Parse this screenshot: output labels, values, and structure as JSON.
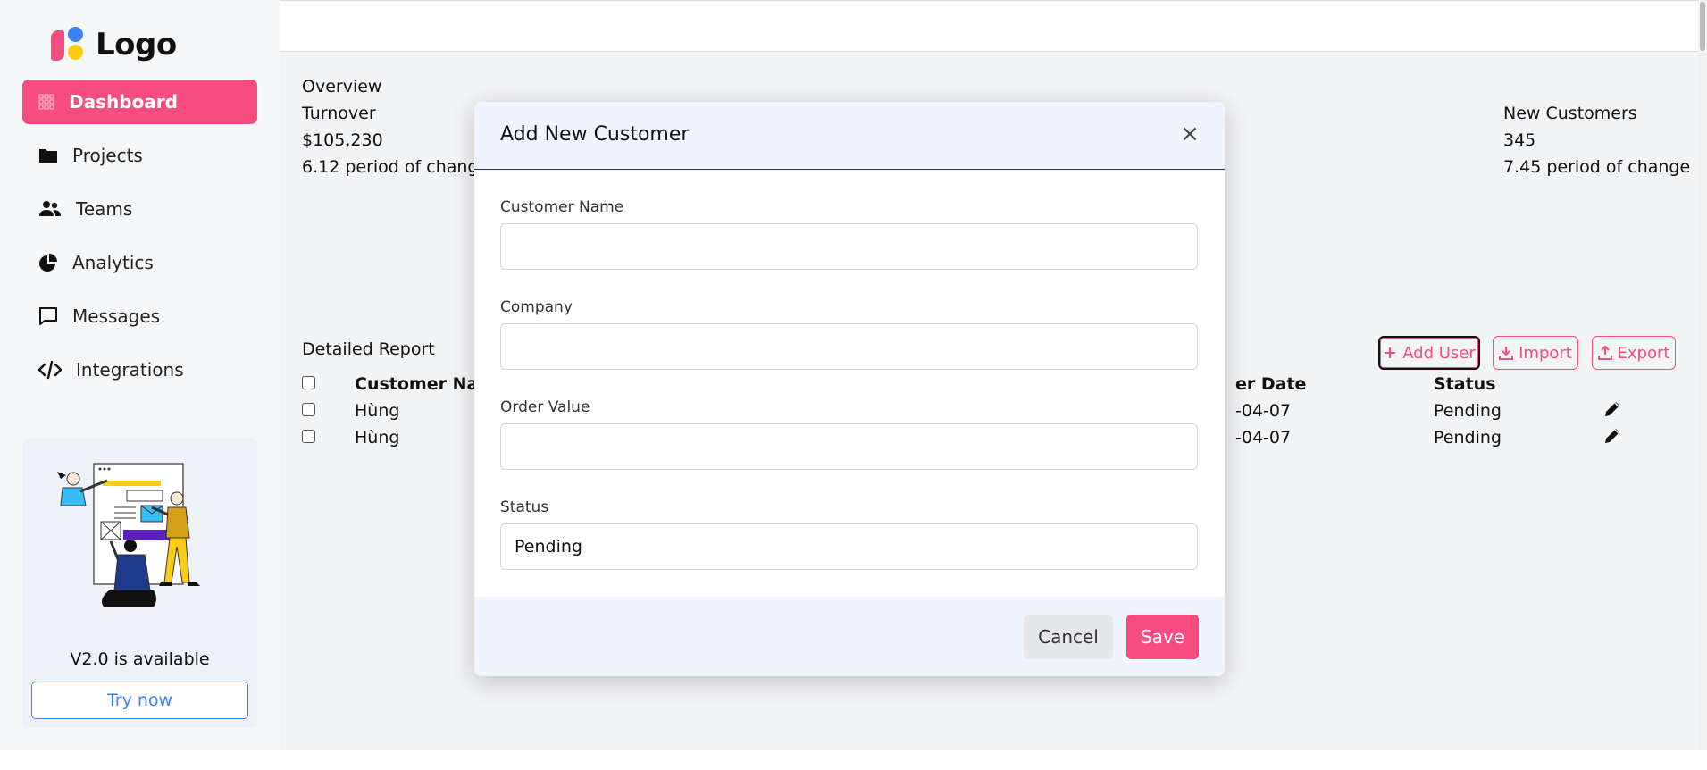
{
  "logo": {
    "text": "Logo"
  },
  "sidebar": {
    "items": [
      {
        "label": "Dashboard",
        "icon": "grid-icon",
        "active": true
      },
      {
        "label": "Projects",
        "icon": "folder-icon"
      },
      {
        "label": "Teams",
        "icon": "users-icon"
      },
      {
        "label": "Analytics",
        "icon": "pie-chart-icon"
      },
      {
        "label": "Messages",
        "icon": "message-icon"
      },
      {
        "label": "Integrations",
        "icon": "code-icon"
      }
    ],
    "promo": {
      "text": "V2.0 is available",
      "button": "Try now"
    }
  },
  "overview": {
    "title": "Overview",
    "turnover": {
      "label": "Turnover",
      "value": "$105,230",
      "change": "6.12 period of change"
    },
    "new_customers": {
      "label": "New Customers",
      "value": "345",
      "change": "7.45 period of change"
    }
  },
  "report": {
    "title": "Detailed Report",
    "actions": {
      "add_user": "Add User",
      "import": "Import",
      "export": "Export"
    },
    "columns": {
      "customer_name": "Customer Nam",
      "order_date": "er Date",
      "status": "Status"
    },
    "rows": [
      {
        "name": "Hùng",
        "date": "-04-07",
        "status": "Pending"
      },
      {
        "name": "Hùng",
        "date": "-04-07",
        "status": "Pending"
      }
    ]
  },
  "modal": {
    "title": "Add New Customer",
    "close": "×",
    "fields": {
      "customer_name": {
        "label": "Customer Name",
        "value": ""
      },
      "company": {
        "label": "Company",
        "value": ""
      },
      "order_value": {
        "label": "Order Value",
        "value": ""
      },
      "status": {
        "label": "Status",
        "value": "Pending"
      }
    },
    "cancel": "Cancel",
    "save": "Save"
  },
  "colors": {
    "accent": "#f74c7f",
    "link": "#3b82f6",
    "modal_tint": "#eef5ff"
  }
}
